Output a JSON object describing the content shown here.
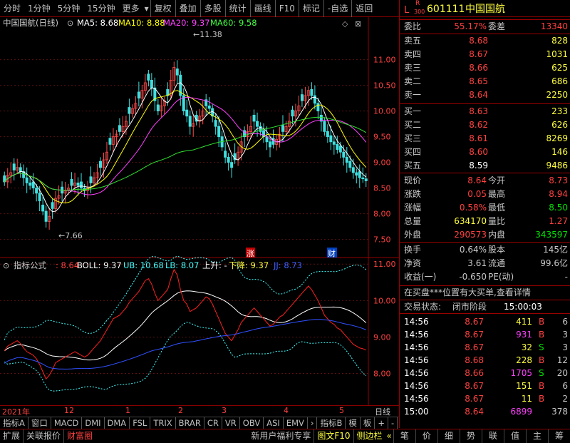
{
  "toolbar": {
    "items": [
      "分时",
      "1分钟",
      "5分钟",
      "15分钟",
      "更多",
      "复权",
      "叠加",
      "多股",
      "统计",
      "画线",
      "F10",
      "标记",
      "-自选",
      "返回"
    ]
  },
  "stock": {
    "code": "601111",
    "name": "中国国航",
    "board_l": "L",
    "board_r": "R",
    "board_num": "300"
  },
  "kline": {
    "title": "中国国航(日线)",
    "ma": [
      {
        "label": "MA5: 8.68",
        "color": "#ffffff"
      },
      {
        "label": "MA10: 8.88",
        "color": "#ffff00"
      },
      {
        "label": "MA20: 9.37",
        "color": "#ff00ff"
      },
      {
        "label": "MA60: 9.58",
        "color": "#00ff00"
      }
    ],
    "high_label": "11.38",
    "low_label": "7.66",
    "marker_zhang": "涨",
    "marker_cai": "财"
  },
  "indicator": {
    "label": "指标公式",
    "v1": "8.64",
    "boll": "BOLL: 9.37",
    "ub": "UB: 10.68",
    "lb": "LB: 8.07",
    "up": "上升: -",
    "down": "下降: 9.37",
    "jj": "JJ: 8.73"
  },
  "xaxis": {
    "labels": [
      "2021年",
      "12",
      "1",
      "2",
      "3",
      "4",
      "5"
    ],
    "end": "日线"
  },
  "bottom_tabs": [
    "指标A",
    "窗口",
    "MACD",
    "DMI",
    "DMA",
    "FSL",
    "TRIX",
    "BRAR",
    "CR",
    "VR",
    "OBV",
    "ASI",
    "EMV",
    "指标B",
    "模",
    "板"
  ],
  "status": {
    "left": [
      "扩展",
      "关联报价",
      "财富圈"
    ],
    "right_text": "新用户福利专享",
    "f10": "图文F10",
    "side": "侧边栏"
  },
  "status_icons": [
    "笔",
    "价",
    "细",
    "势",
    "联",
    "值",
    "主",
    "筹"
  ],
  "quote": {
    "weibi": {
      "label": "委比",
      "value": "55.17%",
      "label2": "委差",
      "value2": "13340"
    },
    "asks": [
      {
        "label": "卖五",
        "price": "8.68",
        "vol": "828"
      },
      {
        "label": "卖四",
        "price": "8.67",
        "vol": "1031"
      },
      {
        "label": "卖三",
        "price": "8.66",
        "vol": "625"
      },
      {
        "label": "卖二",
        "price": "8.65",
        "vol": "686"
      },
      {
        "label": "卖一",
        "price": "8.64",
        "vol": "2250"
      }
    ],
    "bids": [
      {
        "label": "买一",
        "price": "8.63",
        "vol": "233"
      },
      {
        "label": "买二",
        "price": "8.62",
        "vol": "626"
      },
      {
        "label": "买三",
        "price": "8.61",
        "vol": "8269"
      },
      {
        "label": "买四",
        "price": "8.60",
        "vol": "146"
      },
      {
        "label": "买五",
        "price": "8.59",
        "vol": "9486"
      }
    ],
    "stats": [
      {
        "l1": "现价",
        "v1": "8.64",
        "c1": "#ff4040",
        "l2": "今开",
        "v2": "8.73",
        "c2": "#ff4040"
      },
      {
        "l1": "涨跌",
        "v1": "0.05",
        "c1": "#ff4040",
        "l2": "最高",
        "v2": "8.94",
        "c2": "#ff4040"
      },
      {
        "l1": "涨幅",
        "v1": "0.58%",
        "c1": "#ff4040",
        "l2": "最低",
        "v2": "8.50",
        "c2": "#00e000"
      },
      {
        "l1": "总量",
        "v1": "634170",
        "c1": "#ffff40",
        "l2": "量比",
        "v2": "1.27",
        "c2": "#ff4040"
      },
      {
        "l1": "外盘",
        "v1": "290573",
        "c1": "#ff4040",
        "l2": "内盘",
        "v2": "343597",
        "c2": "#00e000"
      }
    ],
    "stats2": [
      {
        "l1": "换手",
        "v1": "0.64%",
        "l2": "股本",
        "v2": "145亿"
      },
      {
        "l1": "净资",
        "v1": "3.61",
        "l2": "流通",
        "v2": "99.6亿"
      },
      {
        "l1": "收益(一)",
        "v1": "-0.650",
        "l2": "PE(动)",
        "v2": "-"
      }
    ],
    "notice": "在买盘***位置有大买单,查看详情",
    "trade_state_label": "交易状态:",
    "trade_state": "闭市阶段",
    "trade_time": "15:00:03"
  },
  "ticks": [
    {
      "time": "14:56",
      "price": "8.67",
      "vol": "411",
      "side": "B",
      "n": "6"
    },
    {
      "time": "14:56",
      "price": "8.67",
      "vol": "931",
      "side": "B",
      "n": "3"
    },
    {
      "time": "14:56",
      "price": "8.67",
      "vol": "32",
      "side": "S",
      "n": "3"
    },
    {
      "time": "14:56",
      "price": "8.68",
      "vol": "228",
      "side": "B",
      "n": "12"
    },
    {
      "time": "14:56",
      "price": "8.66",
      "vol": "1705",
      "side": "S",
      "n": "20"
    },
    {
      "time": "14:56",
      "price": "8.67",
      "vol": "151",
      "side": "B",
      "n": "6"
    },
    {
      "time": "14:56",
      "price": "8.67",
      "vol": "11",
      "side": "B",
      "n": "2"
    },
    {
      "time": "15:00",
      "price": "8.64",
      "vol": "6899",
      "side": "",
      "n": "378"
    }
  ],
  "chart_data": [
    {
      "type": "candlestick",
      "title": "中国国航(日线)",
      "yaxis_ticks": [
        7.5,
        8.0,
        8.5,
        9.0,
        9.5,
        10.0,
        10.5,
        11.0
      ],
      "ylim": [
        7.3,
        11.55
      ],
      "x_labels": [
        "2021年",
        "12",
        "1",
        "2",
        "3",
        "4",
        "5"
      ],
      "close": [
        8.62,
        8.75,
        8.8,
        8.85,
        8.9,
        8.82,
        8.7,
        8.6,
        8.55,
        8.5,
        8.4,
        8.25,
        8.05,
        7.85,
        7.95,
        8.1,
        8.3,
        8.35,
        8.4,
        8.45,
        8.5,
        8.55,
        8.6,
        8.55,
        8.5,
        8.45,
        8.5,
        8.6,
        8.7,
        8.8,
        8.9,
        9.05,
        9.2,
        9.35,
        9.5,
        9.55,
        9.6,
        9.7,
        9.8,
        9.95,
        10.05,
        10.15,
        10.25,
        10.4,
        10.55,
        10.6,
        10.45,
        10.2,
        10.0,
        10.1,
        10.2,
        10.3,
        10.6,
        10.85,
        10.7,
        10.3,
        10.0,
        9.9,
        9.7,
        9.75,
        9.8,
        9.9,
        10.0,
        10.1,
        10.05,
        9.9,
        9.7,
        9.5,
        9.3,
        9.1,
        9.0,
        8.9,
        9.05,
        9.2,
        9.4,
        9.5,
        9.6,
        9.7,
        9.8,
        9.7,
        9.6,
        9.5,
        9.4,
        9.3,
        9.35,
        9.45,
        9.55,
        9.6,
        9.7,
        9.8,
        9.9,
        10.0,
        10.1,
        10.2,
        10.3,
        10.4,
        10.3,
        10.15,
        10.0,
        9.8,
        9.6,
        9.5,
        9.4,
        9.35,
        9.25,
        9.2,
        9.1,
        9.0,
        8.9,
        8.8,
        8.75,
        8.7,
        8.68,
        8.64
      ],
      "high_mark": 11.38,
      "low_mark": 7.66,
      "ma": [
        {
          "name": "MA5",
          "last": 8.68
        },
        {
          "name": "MA10",
          "last": 8.88
        },
        {
          "name": "MA20",
          "last": 9.37
        },
        {
          "name": "MA60",
          "last": 9.58
        }
      ]
    },
    {
      "type": "line",
      "title": "BOLL",
      "yaxis_ticks": [
        8.0,
        9.0,
        10.0,
        11.0
      ],
      "ylim": [
        7.6,
        11.2
      ],
      "series": [
        {
          "name": "BOLL",
          "last": 9.37
        },
        {
          "name": "UB",
          "last": 10.68
        },
        {
          "name": "LB",
          "last": 8.07
        },
        {
          "name": "JJ",
          "last": 8.73
        }
      ]
    }
  ]
}
